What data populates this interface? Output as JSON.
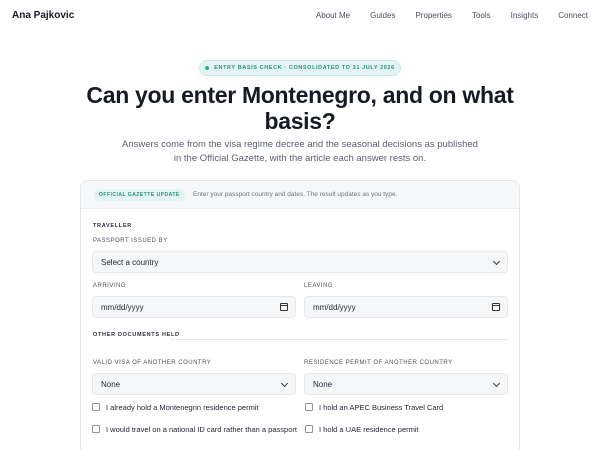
{
  "nav": {
    "brand": "Ana Pajkovic",
    "links": [
      "About Me",
      "Guides",
      "Properties",
      "Tools",
      "Insights",
      "Connect"
    ]
  },
  "hero": {
    "badge": "ENTRY BASIS CHECK · CONSOLIDATED TO 31 JULY 2026",
    "title": "Can you enter Montenegro, and on what basis?",
    "lead": "Answers come from the visa regime decree and the seasonal decisions as published in the Official Gazette, with the article each answer rests on."
  },
  "panel": {
    "tag": "OFFICIAL GAZETTE UPDATE",
    "hint": "Enter your passport country and dates. The result updates as you type."
  },
  "form": {
    "traveller_heading": "TRAVELLER",
    "passport_label": "PASSPORT ISSUED BY",
    "passport_value": "Select a country",
    "arriving_label": "ARRIVING",
    "arriving_value": "mm/dd/yyyy",
    "leaving_label": "LEAVING",
    "leaving_value": "mm/dd/yyyy",
    "docs_heading": "OTHER DOCUMENTS HELD",
    "visa_label": "VALID VISA OF ANOTHER COUNTRY",
    "visa_value": "None",
    "permit_label": "RESIDENCE PERMIT OF ANOTHER COUNTRY",
    "permit_value": "None",
    "checkboxes": [
      {
        "label": "I already hold a Montenegrin residence permit",
        "checked": false
      },
      {
        "label": "I hold an APEC Business Travel Card",
        "checked": false
      },
      {
        "label": "I would travel on a national ID card rather than a passport",
        "checked": false
      },
      {
        "label": "I hold a UAE residence permit",
        "checked": false
      }
    ]
  },
  "colors": {
    "accent": "#2c8e80",
    "accent_bg": "#e3f5f2",
    "field_bg": "#f6f7f9"
  }
}
